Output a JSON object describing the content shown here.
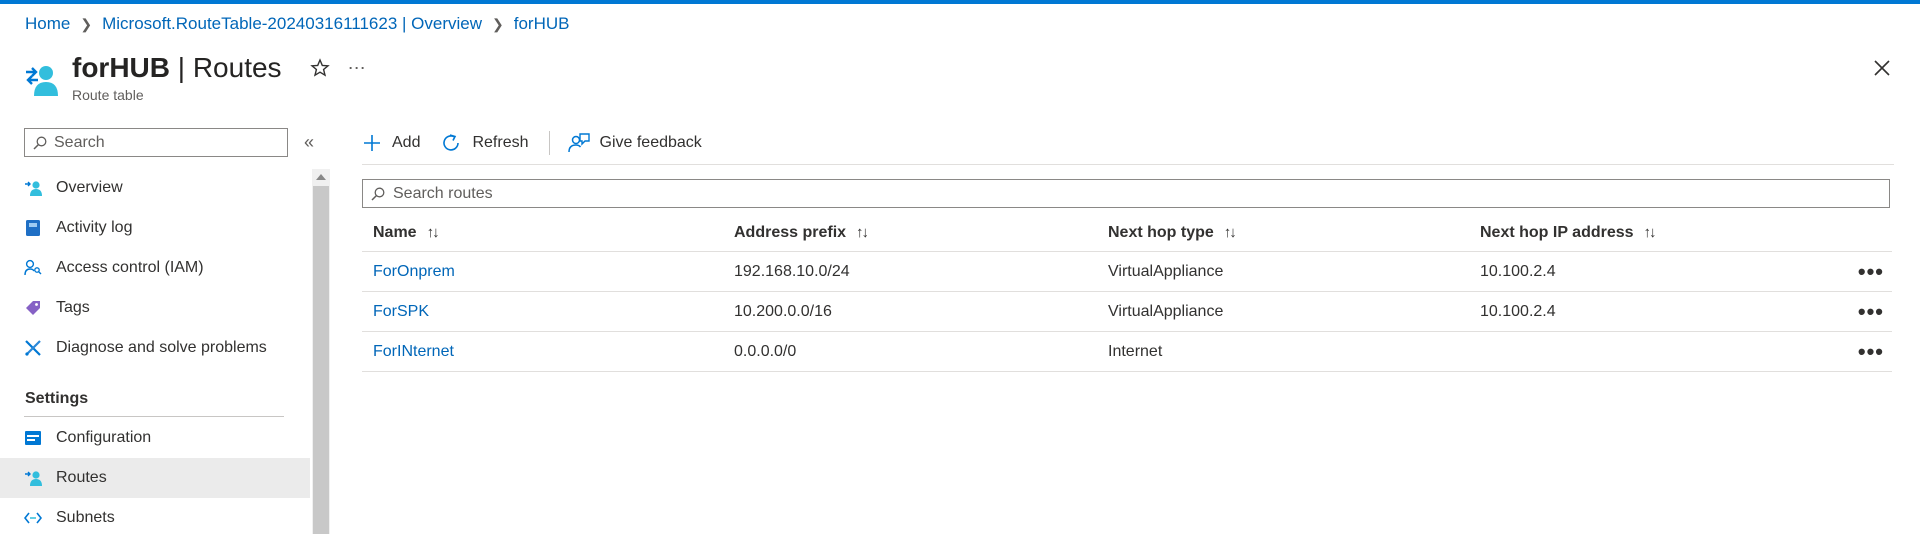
{
  "breadcrumb": {
    "home": "Home",
    "resource": "Microsoft.RouteTable-20240316111623 | Overview",
    "current": "forHUB"
  },
  "header": {
    "title_name": "forHUB",
    "title_suffix": "| Routes",
    "subtitle": "Route table"
  },
  "sidebar": {
    "search_placeholder": "Search",
    "collapse_glyph": "«",
    "items": [
      {
        "label": "Overview",
        "icon": "route-table-icon"
      },
      {
        "label": "Activity log",
        "icon": "activity-log-icon"
      },
      {
        "label": "Access control (IAM)",
        "icon": "iam-icon"
      },
      {
        "label": "Tags",
        "icon": "tag-icon"
      },
      {
        "label": "Diagnose and solve problems",
        "icon": "wrench-icon"
      }
    ],
    "settings_header": "Settings",
    "settings_items": [
      {
        "label": "Configuration",
        "icon": "configuration-icon"
      },
      {
        "label": "Routes",
        "icon": "routes-icon",
        "active": true
      },
      {
        "label": "Subnets",
        "icon": "subnets-icon"
      }
    ]
  },
  "toolbar": {
    "add": "Add",
    "refresh": "Refresh",
    "feedback": "Give feedback"
  },
  "routes_search": {
    "placeholder": "Search routes"
  },
  "table": {
    "columns": [
      "Name",
      "Address prefix",
      "Next hop type",
      "Next hop IP address"
    ],
    "sort_glyph": "↑↓",
    "rows": [
      {
        "name": "ForOnprem",
        "prefix": "192.168.10.0/24",
        "hop_type": "VirtualAppliance",
        "hop_ip": "10.100.2.4"
      },
      {
        "name": "ForSPK",
        "prefix": "10.200.0.0/16",
        "hop_type": "VirtualAppliance",
        "hop_ip": "10.100.2.4"
      },
      {
        "name": "ForINternet",
        "prefix": "0.0.0.0/0",
        "hop_type": "Internet",
        "hop_ip": ""
      }
    ],
    "row_menu_glyph": "•••"
  },
  "colors": {
    "accent": "#0078d4",
    "link": "#0066b8",
    "active_nav": "#ebebeb"
  }
}
